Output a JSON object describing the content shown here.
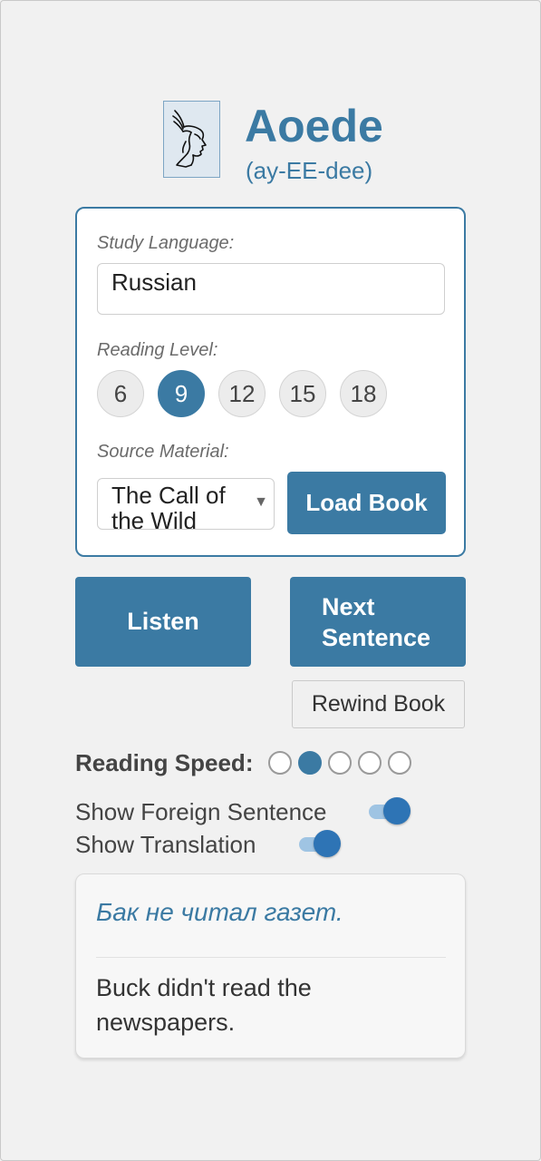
{
  "app": {
    "title": "Aoede",
    "pronunciation": "(ay-EE-dee)"
  },
  "settings": {
    "language_label": "Study Language:",
    "language_value": "Russian",
    "level_label": "Reading Level:",
    "levels": [
      "6",
      "9",
      "12",
      "15",
      "18"
    ],
    "selected_level": "9",
    "source_label": "Source Material:",
    "source_value": "The Call of the Wild",
    "load_button": "Load Book"
  },
  "controls": {
    "listen_button": "Listen",
    "next_button": "Next Sentence",
    "rewind_button": "Rewind Book",
    "speed_label": "Reading Speed:",
    "speed_levels": 5,
    "speed_selected": 2,
    "show_foreign_label": "Show Foreign Sentence",
    "show_foreign_on": true,
    "show_translation_label": "Show Translation",
    "show_translation_on": true
  },
  "sentence": {
    "foreign": "Бак не читал газет.",
    "translation": "Buck didn't read the newspapers."
  },
  "colors": {
    "accent": "#3b7aa3",
    "switch_on": "#2e74b5",
    "background": "#f1f1f1"
  },
  "icons": {
    "logo": "winged-helmet-profile-icon",
    "select_arrow": "triangle-down-icon"
  }
}
